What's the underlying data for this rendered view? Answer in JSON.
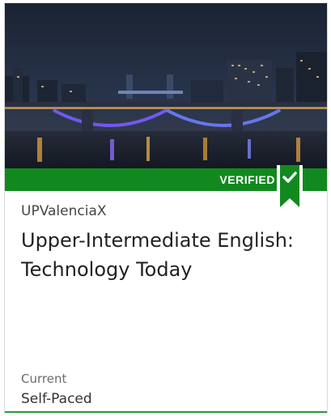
{
  "course": {
    "badge": "VERIFIED",
    "organization": "UPValenciaX",
    "title": "Upper-Intermediate English: Technology Today",
    "status_label": "Current",
    "pace": "Self-Paced",
    "image": "london-bridge-night-photo"
  },
  "colors": {
    "verified_green": "#12891f",
    "accent_green": "#2e9e3a"
  },
  "icons": {
    "ribbon": "bookmark-ribbon-icon",
    "check": "check-icon"
  }
}
